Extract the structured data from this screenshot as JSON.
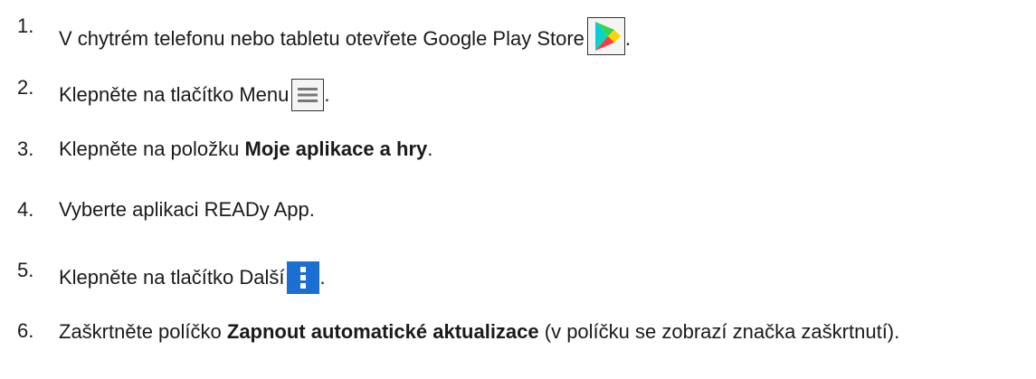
{
  "steps": [
    {
      "number": "1.",
      "text": "V chytrém telefonu nebo tabletu otevřete Google Play Store",
      "suffix": ".",
      "icon": "google-play-icon"
    },
    {
      "number": "2.",
      "text": "Klepněte na tlačítko Menu",
      "suffix": ".",
      "icon": "hamburger-menu-icon"
    },
    {
      "number": "3.",
      "prefix": "Klepněte na položku ",
      "bold": "Moje aplikace a hry",
      "suffix": "."
    },
    {
      "number": "4.",
      "text": "Vyberte aplikaci READy App."
    },
    {
      "number": "5.",
      "text": "Klepněte na tlačítko Další",
      "suffix": ".",
      "icon": "more-vertical-icon"
    },
    {
      "number": "6.",
      "prefix": "Zaškrtněte políčko ",
      "bold": "Zapnout automatické aktualizace",
      "rest": " (v políčku se zobrazí značka zaškrtnutí)."
    }
  ],
  "colors": {
    "text": "#1a1a1a",
    "more_icon_bg": "#1b6fd2"
  }
}
